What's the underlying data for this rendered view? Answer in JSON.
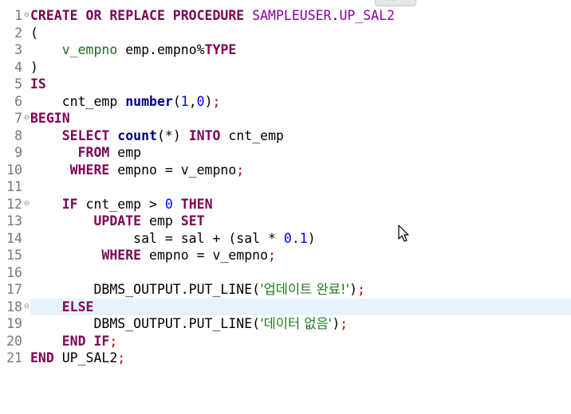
{
  "editor": {
    "lines": [
      {
        "n": "1",
        "fold": "⊖",
        "tokens": [
          [
            "kw",
            "CREATE OR REPLACE PROCEDURE "
          ],
          [
            "obj",
            "SAMPLEUSER"
          ],
          [
            "punct",
            "."
          ],
          [
            "obj",
            "UP_SAL2"
          ]
        ]
      },
      {
        "n": "2",
        "fold": "",
        "tokens": [
          [
            "punct",
            "("
          ]
        ]
      },
      {
        "n": "3",
        "fold": "",
        "tokens": [
          [
            "punct",
            "    "
          ],
          [
            "id",
            "v_empno"
          ],
          [
            "punct",
            " emp.empno%"
          ],
          [
            "kw",
            "TYPE"
          ]
        ]
      },
      {
        "n": "4",
        "fold": "",
        "tokens": [
          [
            "punct",
            ")"
          ]
        ]
      },
      {
        "n": "5",
        "fold": "",
        "tokens": [
          [
            "kw",
            "IS"
          ]
        ]
      },
      {
        "n": "6",
        "fold": "",
        "tokens": [
          [
            "punct",
            "    cnt_emp "
          ],
          [
            "fn",
            "number"
          ],
          [
            "punct",
            "("
          ],
          [
            "num",
            "1"
          ],
          [
            "punct",
            ","
          ],
          [
            "num",
            "0"
          ],
          [
            "punct",
            ")"
          ],
          [
            "semi",
            ";"
          ]
        ]
      },
      {
        "n": "7",
        "fold": "⊖",
        "tokens": [
          [
            "kw",
            "BEGIN"
          ]
        ]
      },
      {
        "n": "8",
        "fold": "",
        "tokens": [
          [
            "punct",
            "    "
          ],
          [
            "kw",
            "SELECT "
          ],
          [
            "fn",
            "count"
          ],
          [
            "punct",
            "(*) "
          ],
          [
            "kw",
            "INTO"
          ],
          [
            "punct",
            " cnt_emp"
          ]
        ]
      },
      {
        "n": "9",
        "fold": "",
        "tokens": [
          [
            "punct",
            "      "
          ],
          [
            "kw",
            "FROM"
          ],
          [
            "punct",
            " emp"
          ]
        ]
      },
      {
        "n": "10",
        "fold": "",
        "tokens": [
          [
            "punct",
            "     "
          ],
          [
            "kw",
            "WHERE"
          ],
          [
            "punct",
            " empno = v_empno"
          ],
          [
            "semi",
            ";"
          ]
        ]
      },
      {
        "n": "11",
        "fold": "",
        "tokens": []
      },
      {
        "n": "12",
        "fold": "⊖",
        "tokens": [
          [
            "punct",
            "    "
          ],
          [
            "kw",
            "IF"
          ],
          [
            "punct",
            " cnt_emp > "
          ],
          [
            "num",
            "0"
          ],
          [
            "punct",
            " "
          ],
          [
            "kw",
            "THEN"
          ]
        ]
      },
      {
        "n": "13",
        "fold": "",
        "tokens": [
          [
            "punct",
            "        "
          ],
          [
            "kw",
            "UPDATE"
          ],
          [
            "punct",
            " emp "
          ],
          [
            "kw",
            "SET"
          ]
        ]
      },
      {
        "n": "14",
        "fold": "",
        "tokens": [
          [
            "punct",
            "             sal = sal + (sal * "
          ],
          [
            "num",
            "0.1"
          ],
          [
            "punct",
            ")"
          ]
        ]
      },
      {
        "n": "15",
        "fold": "",
        "tokens": [
          [
            "punct",
            "         "
          ],
          [
            "kw",
            "WHERE"
          ],
          [
            "punct",
            " empno = v_empno"
          ],
          [
            "semi",
            ";"
          ]
        ]
      },
      {
        "n": "16",
        "fold": "",
        "tokens": []
      },
      {
        "n": "17",
        "fold": "",
        "tokens": [
          [
            "punct",
            "        DBMS_OUTPUT.PUT_LINE("
          ],
          [
            "str-k",
            "'업데이트 완료!'"
          ],
          [
            "punct",
            ")"
          ],
          [
            "semi",
            ";"
          ]
        ]
      },
      {
        "n": "18",
        "fold": "⊖",
        "current": true,
        "tokens": [
          [
            "punct",
            "    "
          ],
          [
            "kw",
            "ELSE"
          ]
        ]
      },
      {
        "n": "19",
        "fold": "",
        "tokens": [
          [
            "punct",
            "        DBMS_OUTPUT.PUT_LINE("
          ],
          [
            "str-k",
            "'데이터 없음'"
          ],
          [
            "punct",
            ")"
          ],
          [
            "semi",
            ";"
          ]
        ]
      },
      {
        "n": "20",
        "fold": "",
        "tokens": [
          [
            "punct",
            "    "
          ],
          [
            "kw",
            "END IF"
          ],
          [
            "semi",
            ";"
          ]
        ]
      },
      {
        "n": "21",
        "fold": "",
        "tokens": [
          [
            "kw",
            "END"
          ],
          [
            "punct",
            " UP_SAL2"
          ],
          [
            "semi",
            ";"
          ]
        ]
      }
    ]
  },
  "icons": {
    "fold": "fold-collapse-icon",
    "cursor": "mouse-pointer-icon",
    "scroll": "scroll-handle-icon"
  }
}
